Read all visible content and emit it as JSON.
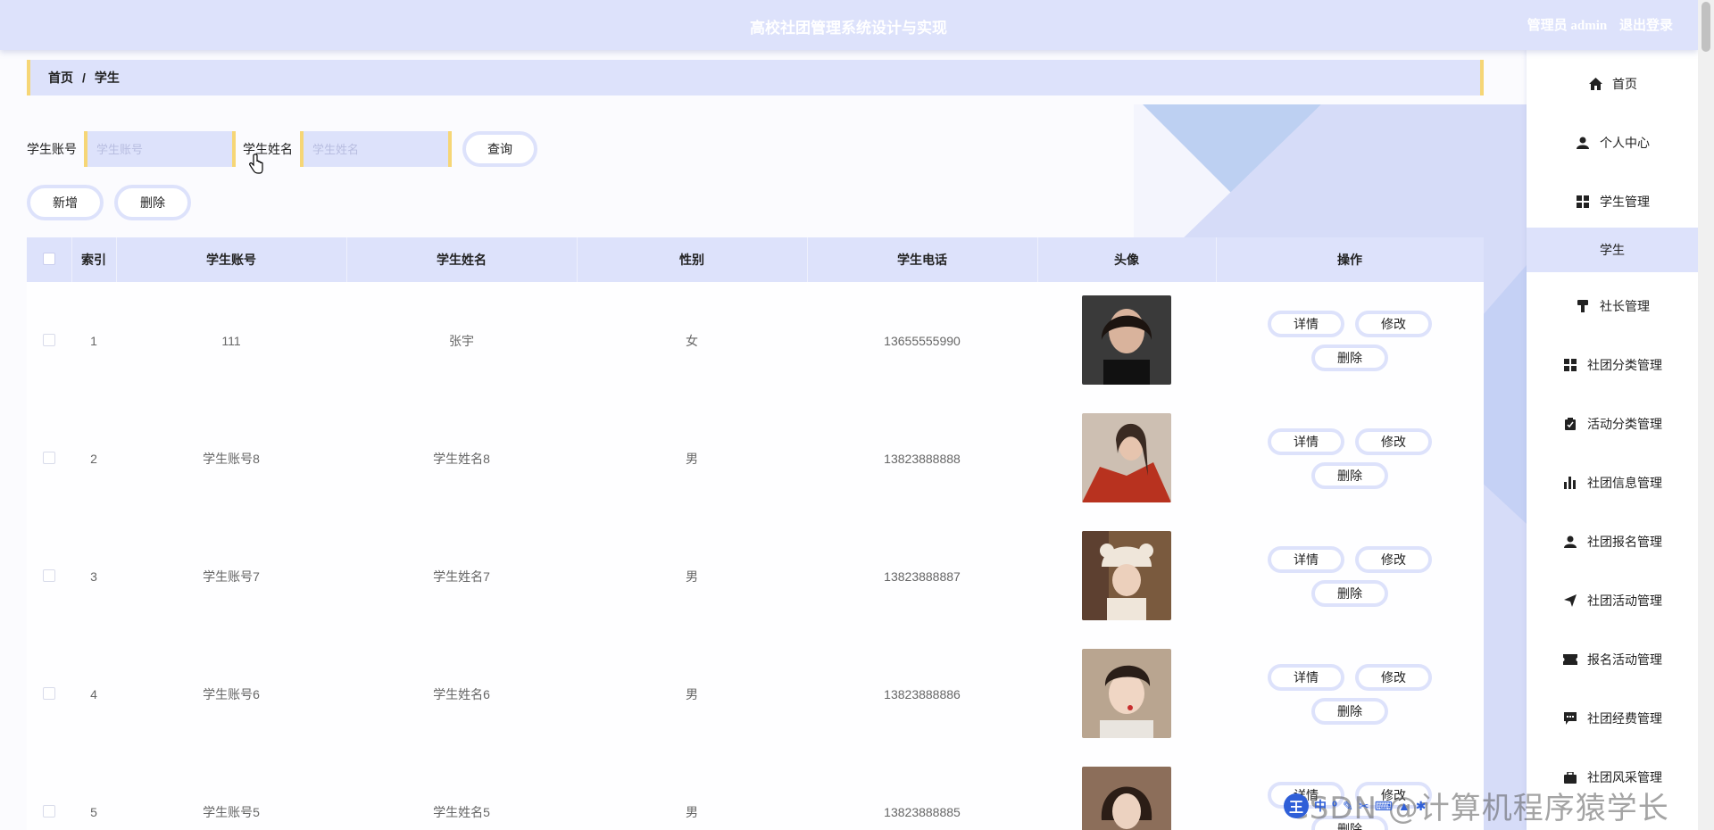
{
  "header": {
    "app_title": "高校社团管理系统设计与实现",
    "user_label": "管理员 admin",
    "logout_label": "退出登录"
  },
  "breadcrumb": {
    "home": "首页",
    "separator": "/",
    "current": "学生"
  },
  "search": {
    "account_label": "学生账号",
    "account_placeholder": "学生账号",
    "name_label": "学生姓名",
    "name_placeholder": "学生姓名",
    "query_button": "查询"
  },
  "actions": {
    "add_button": "新增",
    "delete_button": "删除"
  },
  "table": {
    "columns": [
      "索引",
      "学生账号",
      "学生姓名",
      "性别",
      "学生电话",
      "头像",
      "操作"
    ],
    "rows": [
      {
        "index": "1",
        "account": "111",
        "name": "张宇",
        "gender": "女",
        "phone": "13655555990"
      },
      {
        "index": "2",
        "account": "学生账号8",
        "name": "学生姓名8",
        "gender": "男",
        "phone": "13823888888"
      },
      {
        "index": "3",
        "account": "学生账号7",
        "name": "学生姓名7",
        "gender": "男",
        "phone": "13823888887"
      },
      {
        "index": "4",
        "account": "学生账号6",
        "name": "学生姓名6",
        "gender": "男",
        "phone": "13823888886"
      },
      {
        "index": "5",
        "account": "学生账号5",
        "name": "学生姓名5",
        "gender": "男",
        "phone": "13823888885"
      }
    ],
    "row_actions": {
      "detail": "详情",
      "edit": "修改",
      "delete": "删除"
    }
  },
  "sidebar": {
    "items": [
      {
        "label": "首页",
        "icon": "home-icon"
      },
      {
        "label": "个人中心",
        "icon": "user-icon"
      },
      {
        "label": "学生管理",
        "icon": "grid-icon"
      },
      {
        "label": "学生",
        "icon": "",
        "active": true
      },
      {
        "label": "社长管理",
        "icon": "brush-icon"
      },
      {
        "label": "社团分类管理",
        "icon": "grid-icon"
      },
      {
        "label": "活动分类管理",
        "icon": "clipboard-icon"
      },
      {
        "label": "社团信息管理",
        "icon": "bar-chart-icon"
      },
      {
        "label": "社团报名管理",
        "icon": "user-icon"
      },
      {
        "label": "社团活动管理",
        "icon": "send-icon"
      },
      {
        "label": "报名活动管理",
        "icon": "ticket-icon"
      },
      {
        "label": "社团经费管理",
        "icon": "chat-icon"
      },
      {
        "label": "社团风采管理",
        "icon": "briefcase-icon"
      }
    ]
  },
  "watermark": "CSDN @计算机程序猿学长",
  "colors": {
    "header_bg": "#dde2fb",
    "accent_yellow": "#f6d676",
    "page_bg": "#fbfbfe"
  }
}
